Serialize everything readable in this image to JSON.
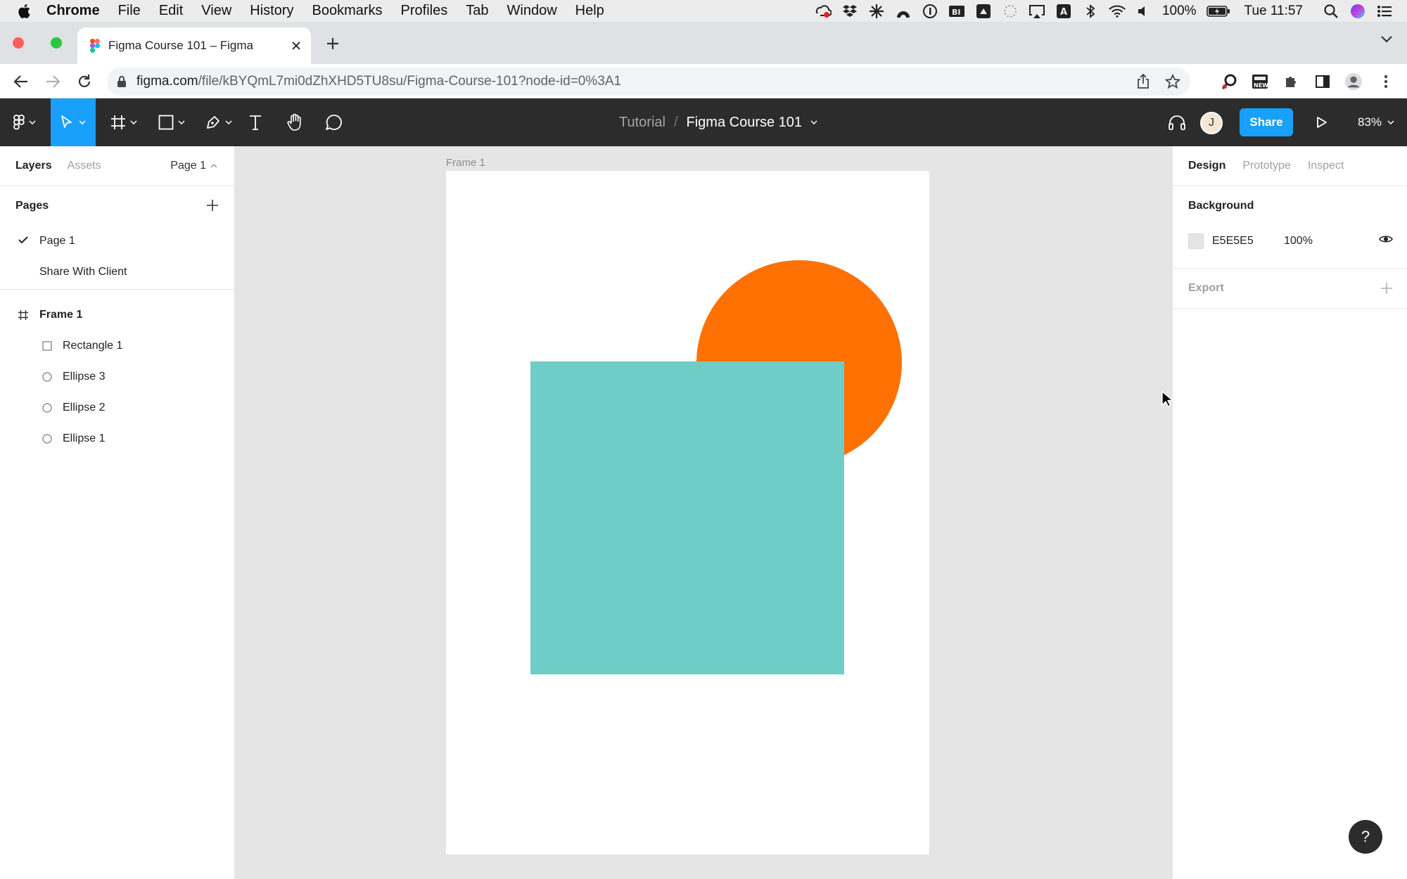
{
  "menubar": {
    "app_name": "Chrome",
    "menus": [
      "File",
      "Edit",
      "View",
      "History",
      "Bookmarks",
      "Profiles",
      "Tab",
      "Window",
      "Help"
    ],
    "battery": "100%",
    "clock": "Tue 11:57"
  },
  "browser": {
    "tab_title": "Figma Course 101 – Figma",
    "url_host": "figma.com",
    "url_path": "/file/kBYQmL7mi0dZhXHD5TU8su/Figma-Course-101?node-id=0%3A1"
  },
  "figma_toolbar": {
    "project": "Tutorial",
    "separator": "/",
    "file_name": "Figma Course 101",
    "avatar_initial": "J",
    "share_label": "Share",
    "zoom": "83%"
  },
  "left_panel": {
    "tabs": [
      "Layers",
      "Assets"
    ],
    "current_page": "Page 1",
    "pages_title": "Pages",
    "pages": [
      "Page 1",
      "Share With Client"
    ],
    "layers": {
      "frame": "Frame 1",
      "children": [
        "Rectangle 1",
        "Ellipse 3",
        "Ellipse 2",
        "Ellipse 1"
      ]
    }
  },
  "canvas": {
    "frame_label": "Frame 1",
    "ellipse_color": "#FF7103",
    "rect_color": "#6ECDC7"
  },
  "right_panel": {
    "tabs": [
      "Design",
      "Prototype",
      "Inspect"
    ],
    "background_title": "Background",
    "background_hex": "E5E5E5",
    "background_opacity": "100%",
    "export_title": "Export"
  },
  "help": "?"
}
